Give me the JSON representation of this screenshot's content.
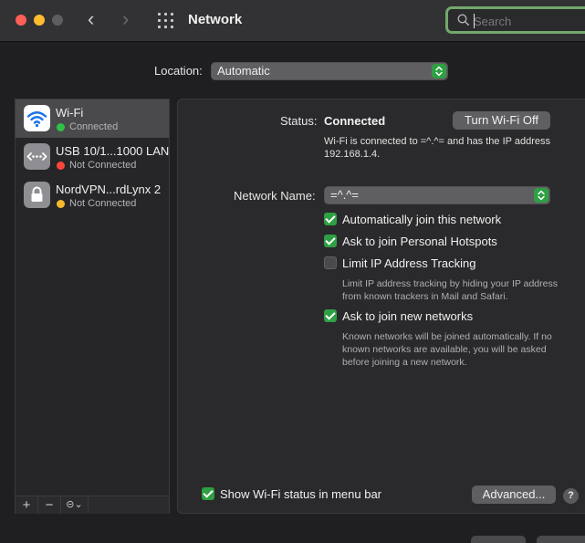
{
  "window": {
    "title": "Network",
    "search_placeholder": "Search"
  },
  "location": {
    "label": "Location:",
    "value": "Automatic"
  },
  "services": [
    {
      "name": "Wi-Fi",
      "status": "Connected",
      "status_color": "#30c048",
      "icon": "wifi-icon"
    },
    {
      "name": "USB 10/1...1000 LAN",
      "status": "Not Connected",
      "status_color": "#ff453a",
      "icon": "ethernet-icon"
    },
    {
      "name": "NordVPN...rdLynx 2",
      "status": "Not Connected",
      "status_color": "#f5b82e",
      "icon": "lock-icon"
    }
  ],
  "sidebar_toolbar": {
    "add": "+",
    "remove": "−",
    "action": "⊝⌄"
  },
  "detail": {
    "status_label": "Status:",
    "status_value": "Connected",
    "turn_off_button": "Turn Wi-Fi Off",
    "wifi_description": "Wi-Fi is connected to =^.^= and has the IP address 192.168.1.4.",
    "network_name_label": "Network Name:",
    "network_name_value": "=^.^=",
    "options": [
      {
        "label": "Automatically join this network",
        "checked": true
      },
      {
        "label": "Ask to join Personal Hotspots",
        "checked": true
      },
      {
        "label": "Limit IP Address Tracking",
        "checked": false
      },
      {
        "label": "Ask to join new networks",
        "checked": true
      }
    ],
    "limit_ip_description": "Limit IP address tracking by hiding your IP address from known trackers in Mail and Safari.",
    "new_networks_description": "Known networks will be joined automatically. If no known networks are available, you will be asked before joining a new network.",
    "show_status_label": "Show Wi-Fi status in menu bar",
    "show_status_checked": true,
    "advanced_button": "Advanced...",
    "help_button": "?"
  },
  "colors": {
    "accent": "#2ea043",
    "search_focus": "#72a86c"
  }
}
